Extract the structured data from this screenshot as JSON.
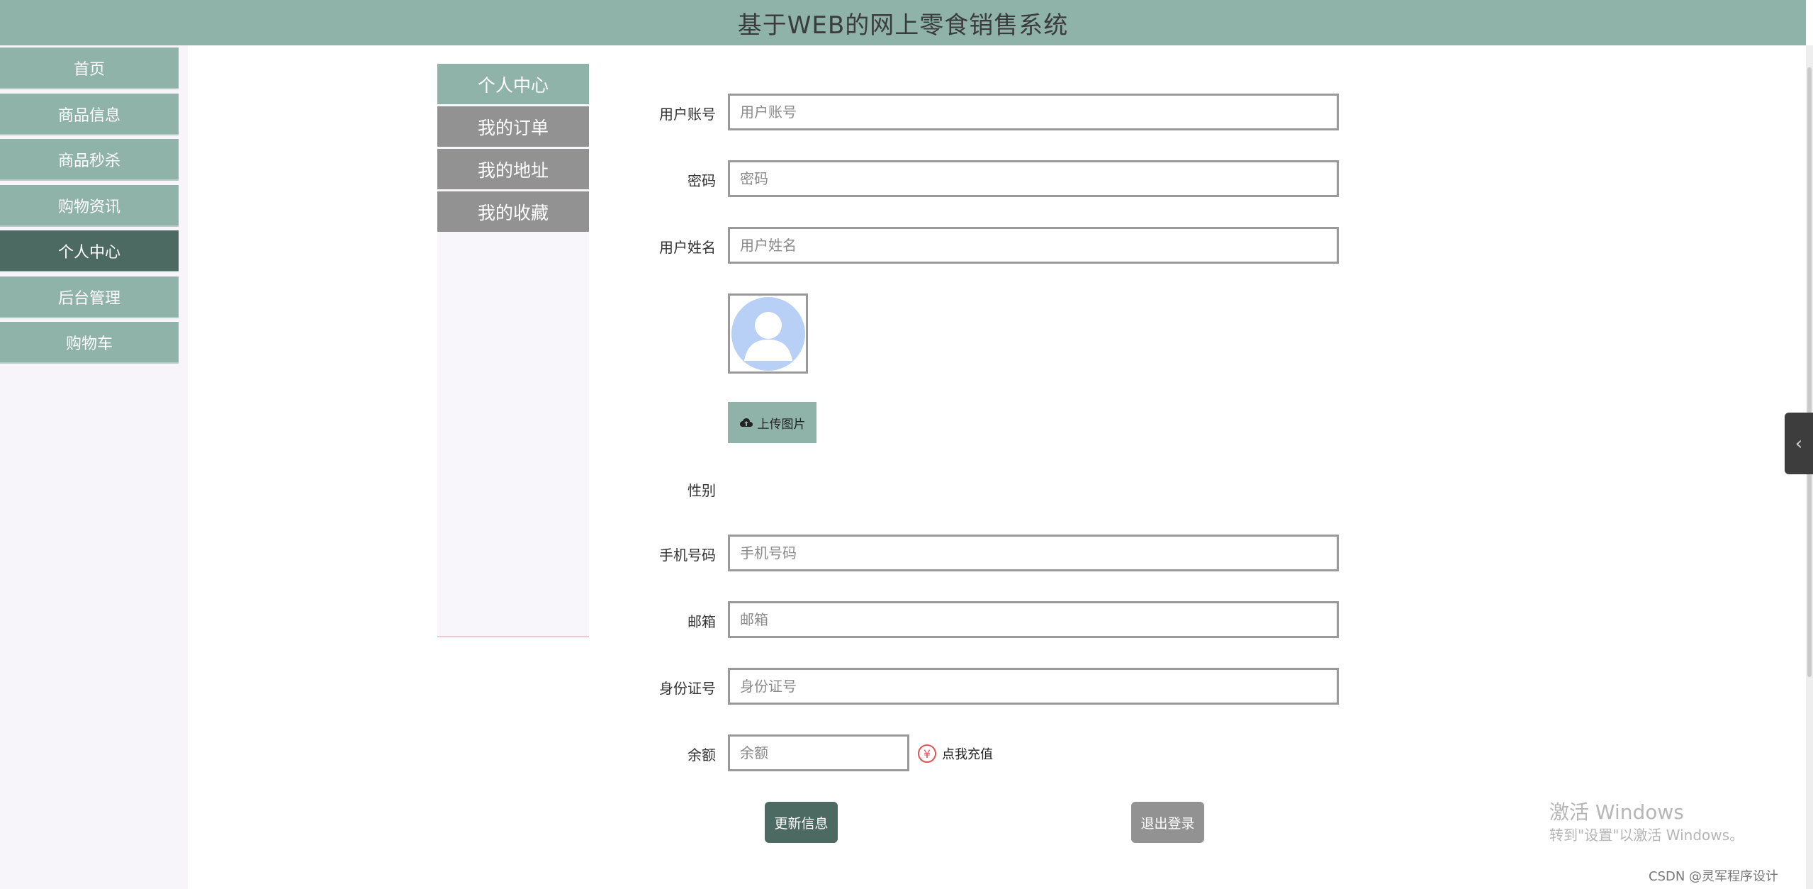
{
  "header": {
    "title": "基于WEB的网上零食销售系统"
  },
  "sidebar": {
    "items": [
      {
        "label": "首页",
        "active": false
      },
      {
        "label": "商品信息",
        "active": false
      },
      {
        "label": "商品秒杀",
        "active": false
      },
      {
        "label": "购物资讯",
        "active": false
      },
      {
        "label": "个人中心",
        "active": true
      },
      {
        "label": "后台管理",
        "active": false
      },
      {
        "label": "购物车",
        "active": false
      }
    ]
  },
  "subnav": {
    "items": [
      {
        "label": "个人中心",
        "active": true
      },
      {
        "label": "我的订单",
        "active": false
      },
      {
        "label": "我的地址",
        "active": false
      },
      {
        "label": "我的收藏",
        "active": false
      }
    ]
  },
  "form": {
    "username": {
      "label": "用户账号",
      "placeholder": "用户账号",
      "value": ""
    },
    "password": {
      "label": "密码",
      "placeholder": "密码",
      "value": ""
    },
    "realname": {
      "label": "用户姓名",
      "placeholder": "用户姓名",
      "value": ""
    },
    "upload_label": "上传图片",
    "gender": {
      "label": "性别"
    },
    "phone": {
      "label": "手机号码",
      "placeholder": "手机号码",
      "value": ""
    },
    "email": {
      "label": "邮箱",
      "placeholder": "邮箱",
      "value": ""
    },
    "idcard": {
      "label": "身份证号",
      "placeholder": "身份证号",
      "value": ""
    },
    "balance": {
      "label": "余额",
      "placeholder": "余额",
      "value": ""
    },
    "recharge_label": "点我充值",
    "recharge_icon": "¥",
    "update_label": "更新信息",
    "logout_label": "退出登录"
  },
  "colors": {
    "accent": "#8fb3a8",
    "active": "#4c6a61",
    "gray": "#929292"
  },
  "watermark": {
    "line1": "激活 Windows",
    "line2": "转到\"设置\"以激活 Windows。"
  },
  "credit": "CSDN @灵军程序设计",
  "side_tab_icon": "‹"
}
